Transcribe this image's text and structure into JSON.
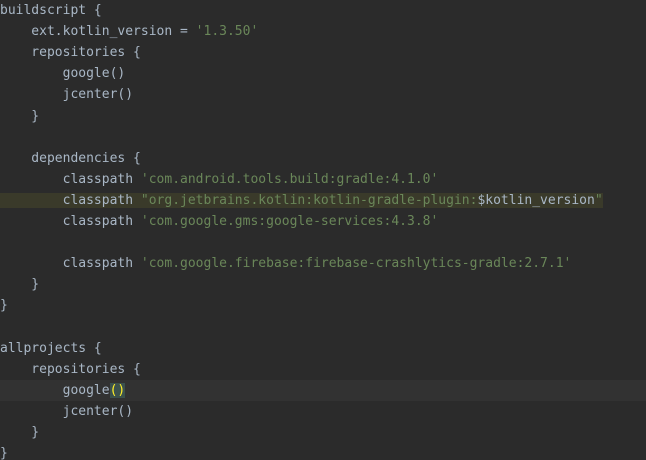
{
  "editor": {
    "colors": {
      "background": "#2b2b2b",
      "text": "#a9b7c6",
      "string": "#6a8759",
      "highlight_line": "#323232",
      "highlight_range": "#3a3a2a",
      "brace_match": "#ffef28"
    },
    "lines": [
      {
        "id": "l1",
        "tokens": [
          {
            "t": "buildscript {",
            "k": "plain"
          }
        ]
      },
      {
        "id": "l2",
        "tokens": [
          {
            "t": "    ext.kotlin_version = ",
            "k": "plain"
          },
          {
            "t": "'1.3.50'",
            "k": "str"
          }
        ]
      },
      {
        "id": "l3",
        "tokens": [
          {
            "t": "    repositories {",
            "k": "plain"
          }
        ]
      },
      {
        "id": "l4",
        "tokens": [
          {
            "t": "        google()",
            "k": "plain"
          }
        ]
      },
      {
        "id": "l5",
        "tokens": [
          {
            "t": "        jcenter()",
            "k": "plain"
          }
        ]
      },
      {
        "id": "l6",
        "tokens": [
          {
            "t": "    }",
            "k": "plain"
          }
        ]
      },
      {
        "id": "l7",
        "tokens": []
      },
      {
        "id": "l8",
        "tokens": [
          {
            "t": "    dependencies {",
            "k": "plain"
          }
        ]
      },
      {
        "id": "l9",
        "tokens": [
          {
            "t": "        classpath ",
            "k": "plain"
          },
          {
            "t": "'com.android.tools.build:gradle:4.1.0'",
            "k": "str"
          }
        ]
      },
      {
        "id": "l10",
        "tokens": [
          {
            "t": "        classpath ",
            "k": "plain",
            "hl": true
          },
          {
            "t": "\"org.jetbrains.kotlin:kotlin-gradle-plugin:",
            "k": "str",
            "hl": true
          },
          {
            "t": "$kotlin_version",
            "k": "plain",
            "hl": true
          },
          {
            "t": "\"",
            "k": "str",
            "hl": true
          }
        ]
      },
      {
        "id": "l11",
        "tokens": [
          {
            "t": "        classpath ",
            "k": "plain"
          },
          {
            "t": "'com.google.gms:google-services:4.3.8'",
            "k": "str"
          }
        ]
      },
      {
        "id": "l12",
        "tokens": []
      },
      {
        "id": "l13",
        "tokens": [
          {
            "t": "        classpath ",
            "k": "plain"
          },
          {
            "t": "'com.google.firebase:firebase-crashlytics-gradle:2.7.1'",
            "k": "str"
          }
        ]
      },
      {
        "id": "l14",
        "tokens": [
          {
            "t": "    }",
            "k": "plain"
          }
        ]
      },
      {
        "id": "l15",
        "tokens": [
          {
            "t": "}",
            "k": "plain"
          }
        ]
      },
      {
        "id": "l16",
        "tokens": []
      },
      {
        "id": "l17",
        "tokens": [
          {
            "t": "allprojects {",
            "k": "plain"
          }
        ]
      },
      {
        "id": "l18",
        "tokens": [
          {
            "t": "    repositories {",
            "k": "plain"
          }
        ]
      },
      {
        "id": "l19",
        "current": true,
        "tokens": [
          {
            "t": "        google",
            "k": "plain"
          },
          {
            "t": "()",
            "k": "brace"
          }
        ]
      },
      {
        "id": "l20",
        "tokens": [
          {
            "t": "        jcenter()",
            "k": "plain"
          }
        ]
      },
      {
        "id": "l21",
        "tokens": [
          {
            "t": "    }",
            "k": "plain"
          }
        ]
      },
      {
        "id": "l22",
        "tokens": [
          {
            "t": "}",
            "k": "plain"
          }
        ]
      }
    ]
  }
}
